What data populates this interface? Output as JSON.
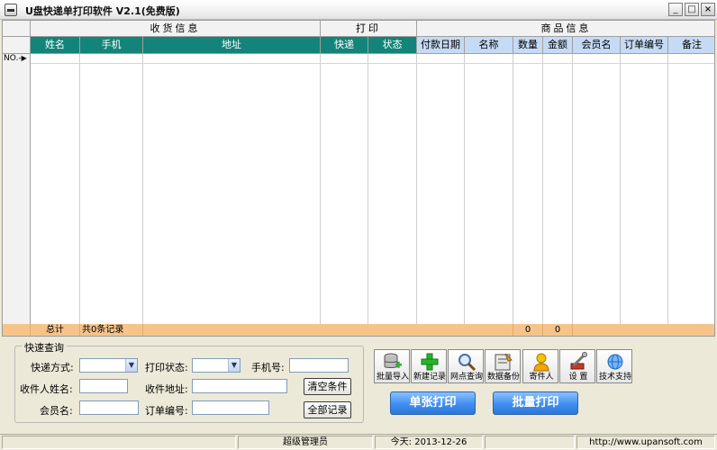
{
  "window": {
    "title": "U盘快递单打印软件 V2.1(免费版)",
    "buttons": {
      "minimize": "_",
      "maximize": "□",
      "close": "×"
    }
  },
  "grid": {
    "groups": [
      "收货信息",
      "打印",
      "商品信息"
    ],
    "columns": [
      "姓名",
      "手机",
      "地址",
      "快递",
      "状态",
      "付款日期",
      "名称",
      "数量",
      "金额",
      "会员名",
      "订单编号",
      "备注"
    ],
    "row_marker": "NO.-",
    "total": {
      "label": "总计",
      "records": "共0条记录",
      "qty": "0",
      "amount": "0"
    }
  },
  "query": {
    "legend": "快速查询",
    "labels": {
      "express": "快递方式:",
      "print_status": "打印状态:",
      "phone": "手机号:",
      "receiver": "收件人姓名:",
      "address": "收件地址:",
      "member": "会员名:",
      "order": "订单编号:"
    },
    "clear_button": "清空条件",
    "all_button": "全部记录"
  },
  "toolbar": [
    "批量导入",
    "新建记录",
    "网点查询",
    "数据备份",
    "寄件人",
    "设 置",
    "技术支持"
  ],
  "actions": {
    "single_print": "单张打印",
    "batch_print": "批量打印"
  },
  "status": {
    "user": "超级管理员",
    "date": "今天: 2013-12-26",
    "url": "http://www.upansoft.com"
  }
}
